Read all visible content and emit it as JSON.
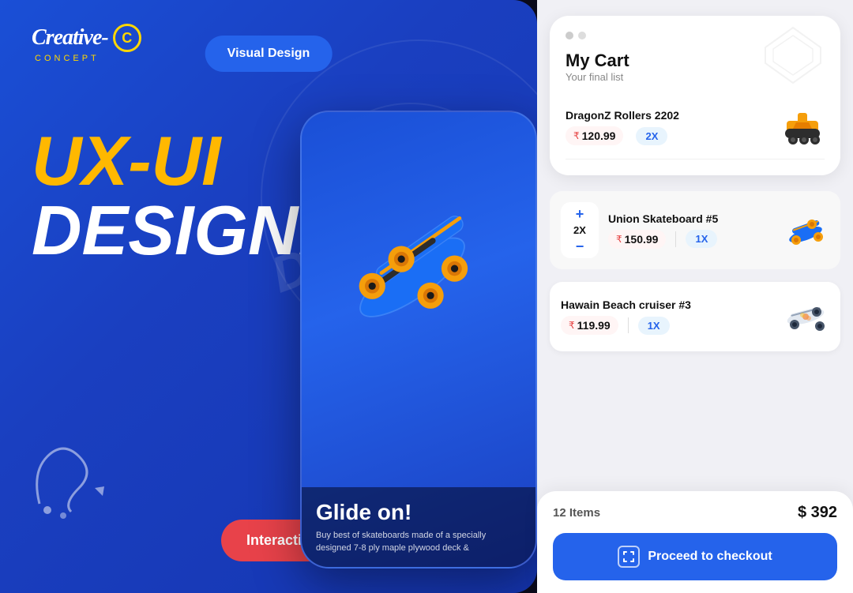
{
  "logo": {
    "text": "Creative-",
    "icon": "C",
    "subtitle": "CONCEPT"
  },
  "header": {
    "visual_design_btn": "Visual Design"
  },
  "hero": {
    "line1": "UX-UI",
    "line2": "DESIGN.."
  },
  "interactive_btn": "Interactive",
  "phone": {
    "glide_heading": "Glide on!",
    "description": "Buy best of skateboards made of a specially designed 7-8 ply maple plywood deck &",
    "dream_text": "Dream big"
  },
  "cart": {
    "title": "My Cart",
    "subtitle": "Your final list",
    "items": [
      {
        "name": "DragonZ Rollers 2202",
        "price": "120.99",
        "qty": "2X"
      },
      {
        "name": "Union Skateboard #5",
        "price": "150.99",
        "qty": "1X"
      },
      {
        "name": "Hawain Beach cruiser #3",
        "price": "119.99",
        "qty": "1X"
      }
    ],
    "qty_controls": {
      "plus": "+",
      "qty_label": "2X",
      "minus": "−"
    },
    "total_items": "12 Items",
    "total_amount": "$ 392",
    "checkout_btn": "Proceed to checkout"
  }
}
